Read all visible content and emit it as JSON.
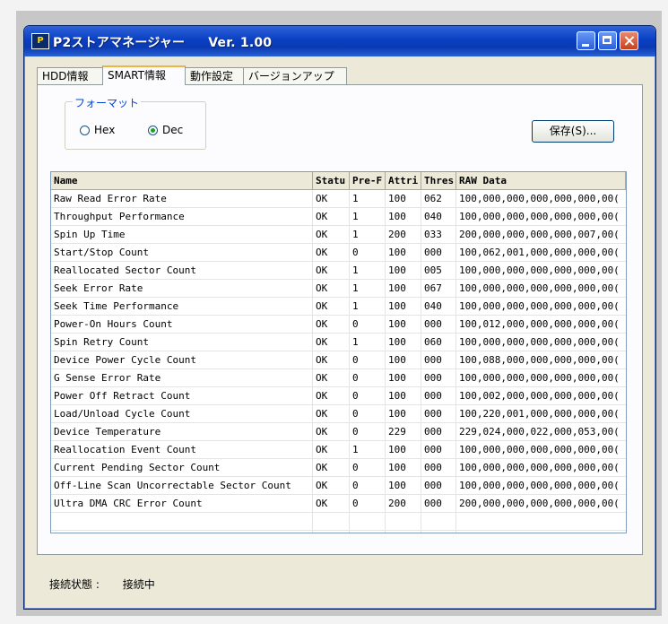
{
  "window": {
    "title": "P2ストアマネージャー",
    "version": "Ver. 1.00",
    "icon_text": "P"
  },
  "tabs": [
    {
      "label": "HDD情報",
      "active": false
    },
    {
      "label": "SMART情報",
      "active": true
    },
    {
      "label": "動作設定",
      "active": false
    },
    {
      "label": "バージョンアップ",
      "active": false
    }
  ],
  "format": {
    "legend": "フォーマット",
    "options": [
      {
        "label": "Hex",
        "selected": false
      },
      {
        "label": "Dec",
        "selected": true
      }
    ]
  },
  "save_button": "保存(S)...",
  "table": {
    "headers": [
      "Name",
      "Statu",
      "Pre-F",
      "Attri",
      "Thres",
      "RAW Data"
    ],
    "rows": [
      [
        "Raw Read Error Rate",
        "OK",
        "1",
        "100",
        "062",
        "100,000,000,000,000,000,00("
      ],
      [
        "Throughput Performance",
        "OK",
        "1",
        "100",
        "040",
        "100,000,000,000,000,000,00("
      ],
      [
        "Spin Up Time",
        "OK",
        "1",
        "200",
        "033",
        "200,000,000,000,000,007,00("
      ],
      [
        "Start/Stop Count",
        "OK",
        "0",
        "100",
        "000",
        "100,062,001,000,000,000,00("
      ],
      [
        "Reallocated Sector Count",
        "OK",
        "1",
        "100",
        "005",
        "100,000,000,000,000,000,00("
      ],
      [
        "Seek Error Rate",
        "OK",
        "1",
        "100",
        "067",
        "100,000,000,000,000,000,00("
      ],
      [
        "Seek Time Performance",
        "OK",
        "1",
        "100",
        "040",
        "100,000,000,000,000,000,00("
      ],
      [
        "Power-On Hours Count",
        "OK",
        "0",
        "100",
        "000",
        "100,012,000,000,000,000,00("
      ],
      [
        "Spin Retry Count",
        "OK",
        "1",
        "100",
        "060",
        "100,000,000,000,000,000,00("
      ],
      [
        "Device Power Cycle Count",
        "OK",
        "0",
        "100",
        "000",
        "100,088,000,000,000,000,00("
      ],
      [
        "G Sense Error Rate",
        "OK",
        "0",
        "100",
        "000",
        "100,000,000,000,000,000,00("
      ],
      [
        "Power Off Retract Count",
        "OK",
        "0",
        "100",
        "000",
        "100,002,000,000,000,000,00("
      ],
      [
        "Load/Unload Cycle Count",
        "OK",
        "0",
        "100",
        "000",
        "100,220,001,000,000,000,00("
      ],
      [
        "Device Temperature",
        "OK",
        "0",
        "229",
        "000",
        "229,024,000,022,000,053,00("
      ],
      [
        "Reallocation Event Count",
        "OK",
        "1",
        "100",
        "000",
        "100,000,000,000,000,000,00("
      ],
      [
        "Current Pending Sector Count",
        "OK",
        "0",
        "100",
        "000",
        "100,000,000,000,000,000,00("
      ],
      [
        "Off-Line Scan Uncorrectable Sector Count",
        "OK",
        "0",
        "100",
        "000",
        "100,000,000,000,000,000,00("
      ],
      [
        "Ultra DMA CRC Error Count",
        "OK",
        "0",
        "200",
        "000",
        "200,000,000,000,000,000,00("
      ]
    ]
  },
  "status_bar": {
    "label": "接続状態 :",
    "value": "接続中"
  }
}
